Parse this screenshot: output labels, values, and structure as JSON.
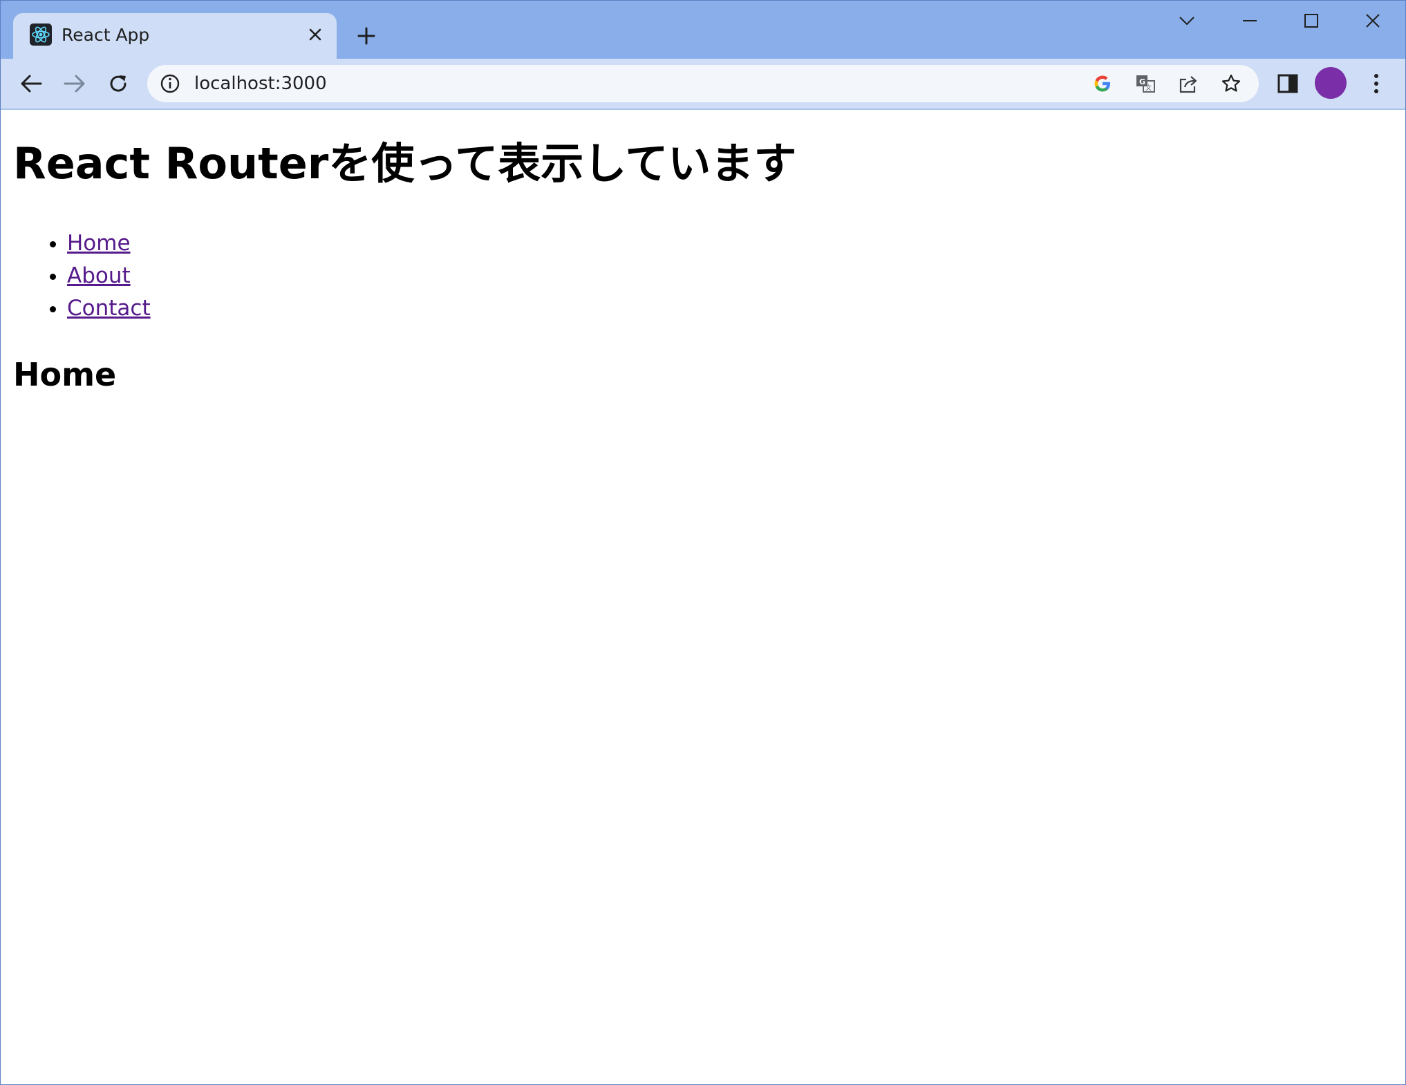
{
  "browser": {
    "tab": {
      "title": "React App",
      "favicon": "react-logo-icon"
    },
    "new_tab_icon": "plus-icon",
    "window_controls": [
      "tab-search-icon",
      "minimize-icon",
      "maximize-icon",
      "close-icon"
    ],
    "toolbar": {
      "back_icon": "arrow-left-icon",
      "forward_icon": "arrow-right-icon",
      "reload_icon": "reload-icon",
      "address": "localhost:3000",
      "site_info_icon": "info-icon",
      "omnibox_actions": [
        "google-icon",
        "translate-icon",
        "share-icon",
        "bookmark-star-icon"
      ],
      "side_panel_icon": "side-panel-icon",
      "menu_icon": "more-vert-icon"
    },
    "colors": {
      "tabstrip": "#89aee9",
      "toolbar": "#cfdef6",
      "avatar": "#7a2fa8",
      "visited_link": "#551a8b"
    }
  },
  "page": {
    "heading": "React Routerを使って表示しています",
    "nav": [
      {
        "label": "Home"
      },
      {
        "label": "About"
      },
      {
        "label": "Contact"
      }
    ],
    "current_route_heading": "Home"
  }
}
